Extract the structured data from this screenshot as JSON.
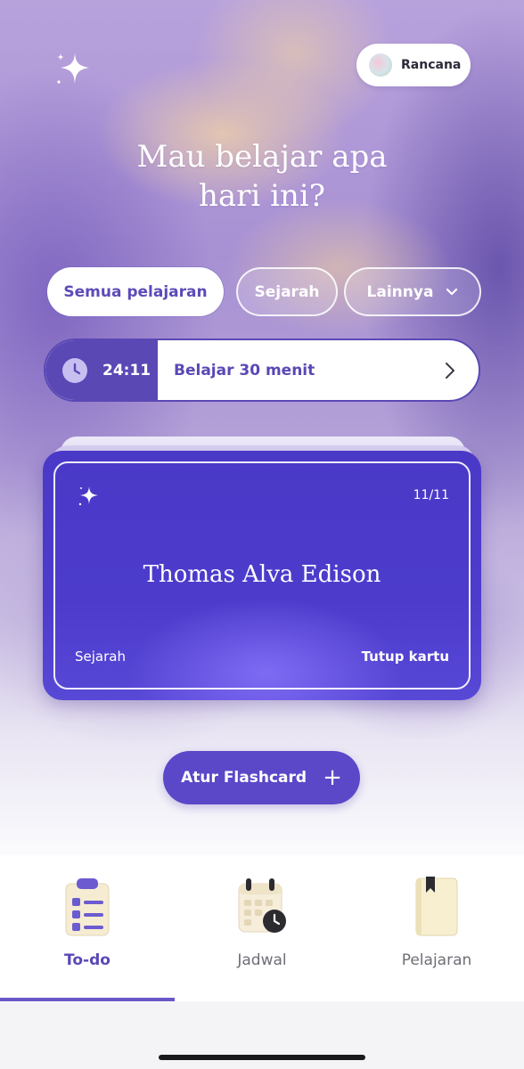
{
  "header": {
    "profile_name": "Rancana",
    "headline_line1": "Mau belajar apa",
    "headline_line2": "hari ini?"
  },
  "filters": {
    "chips": [
      {
        "label": "Semua pelajaran",
        "active": true
      },
      {
        "label": "Sejarah",
        "active": false
      },
      {
        "label": "Lainnya",
        "active": false,
        "has_dropdown": true
      }
    ]
  },
  "timer": {
    "value": "24:11",
    "label": "Belajar 30 menit",
    "icon": "clock-icon",
    "action_icon": "chevron-right-icon"
  },
  "flashcard": {
    "counter": "11/11",
    "term": "Thomas Alva Edison",
    "subject": "Sejarah",
    "close_label": "Tutup kartu",
    "icon": "sparkle-icon"
  },
  "manage_button": {
    "label": "Atur Flashcard",
    "icon": "plus-icon"
  },
  "tabbar": {
    "tabs": [
      {
        "label": "To-do",
        "icon": "checklist-icon",
        "active": true
      },
      {
        "label": "Jadwal",
        "icon": "calendar-clock-icon",
        "active": false
      },
      {
        "label": "Pelajaran",
        "icon": "book-icon",
        "active": false
      }
    ]
  },
  "colors": {
    "accent": "#5a48b5",
    "card": "#4a39c7",
    "white": "#ffffff"
  }
}
